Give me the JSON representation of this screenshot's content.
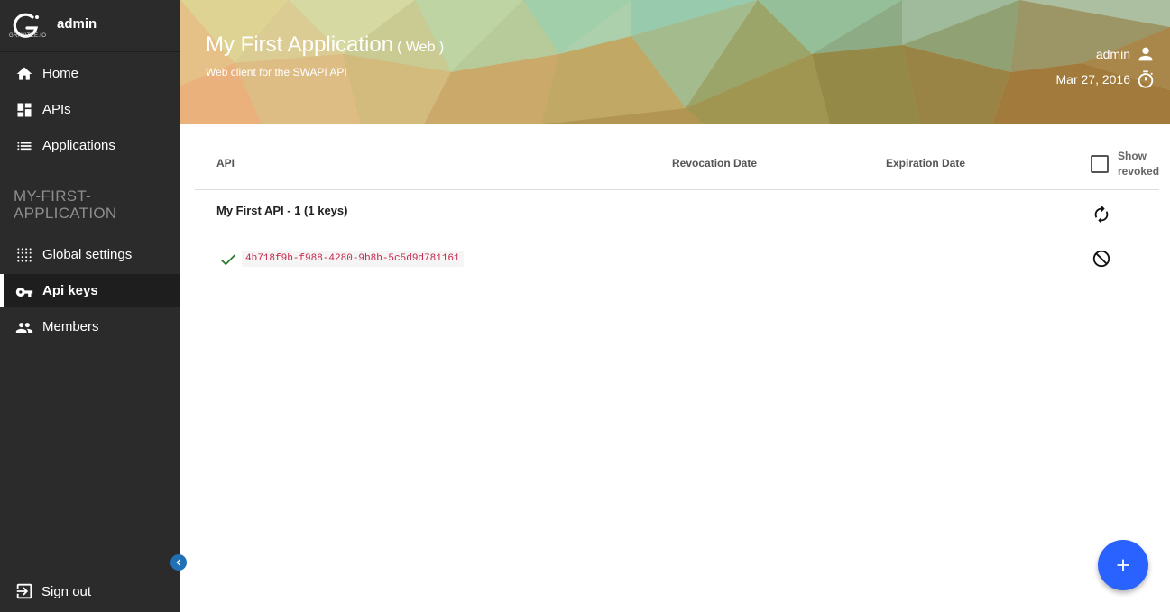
{
  "sidebar": {
    "logo_text": "GRAVITEE.IO",
    "username": "admin",
    "nav": [
      {
        "label": "Home",
        "icon": "home-icon"
      },
      {
        "label": "APIs",
        "icon": "dashboard-icon"
      },
      {
        "label": "Applications",
        "icon": "list-icon"
      }
    ],
    "section_title": "MY-FIRST-APPLICATION",
    "app_nav": [
      {
        "label": "Global settings",
        "icon": "grid-icon"
      },
      {
        "label": "Api keys",
        "icon": "key-icon",
        "active": true
      },
      {
        "label": "Members",
        "icon": "people-icon"
      }
    ],
    "signout": "Sign out"
  },
  "header": {
    "title": "My First Application",
    "type": "( Web )",
    "description": "Web client for the SWAPI API",
    "user": "admin",
    "date": "Mar 27, 2016"
  },
  "table": {
    "columns": {
      "api": "API",
      "revocation": "Revocation Date",
      "expiration": "Expiration Date"
    },
    "show_revoked": "Show revoked",
    "show_revoked_checked": false,
    "group": {
      "title": "My First API - 1 (1 keys)"
    },
    "keys": [
      {
        "key": "4b718f9b-f988-4280-9b8b-5c5d9d781161",
        "status": "valid"
      }
    ]
  },
  "colors": {
    "sidebar_bg": "#2b2b2b",
    "accent": "#2962ff",
    "key_text": "#c7254e",
    "check": "#2e7d32"
  }
}
